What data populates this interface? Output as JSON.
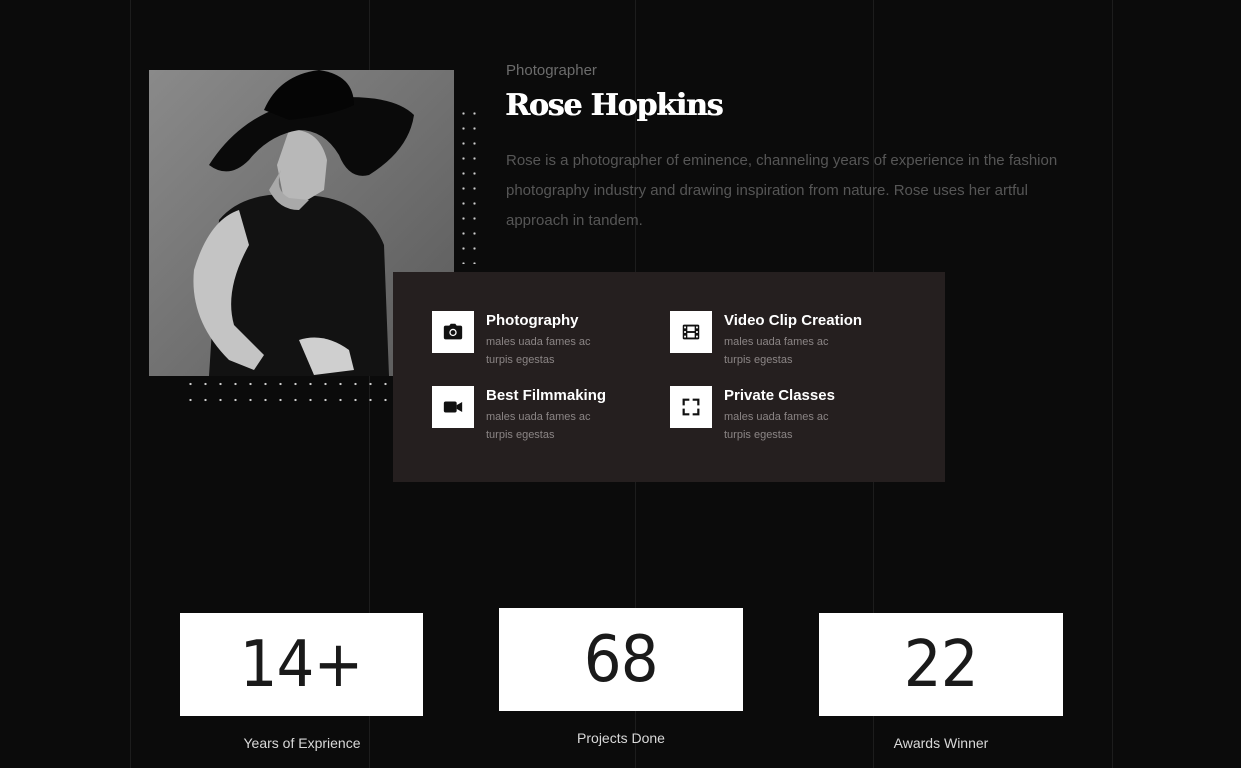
{
  "profile": {
    "role": "Photographer",
    "name": "Rose Hopkins",
    "bio": "Rose is a photographer of eminence, channeling years of experience in the fashion photography industry and drawing inspiration from nature. Rose uses her artful approach in tandem."
  },
  "services": [
    {
      "title": "Photography",
      "description": "males uada fames ac turpis egestas",
      "icon": "camera-icon"
    },
    {
      "title": "Video Clip Creation",
      "description": "males uada fames ac turpis egestas",
      "icon": "film-strip-icon"
    },
    {
      "title": "Best Filmmaking",
      "description": "males uada fames ac turpis egestas",
      "icon": "video-camera-icon"
    },
    {
      "title": "Private Classes",
      "description": "males uada fames ac turpis egestas",
      "icon": "expand-icon"
    }
  ],
  "stats": [
    {
      "value": "14+",
      "label": "Years of Exprience"
    },
    {
      "value": "68",
      "label": "Projects Done"
    },
    {
      "value": "22",
      "label": "Awards Winner"
    }
  ],
  "colors": {
    "background": "#0b0b0b",
    "card": "#251f1f",
    "text_muted": "#565656"
  }
}
